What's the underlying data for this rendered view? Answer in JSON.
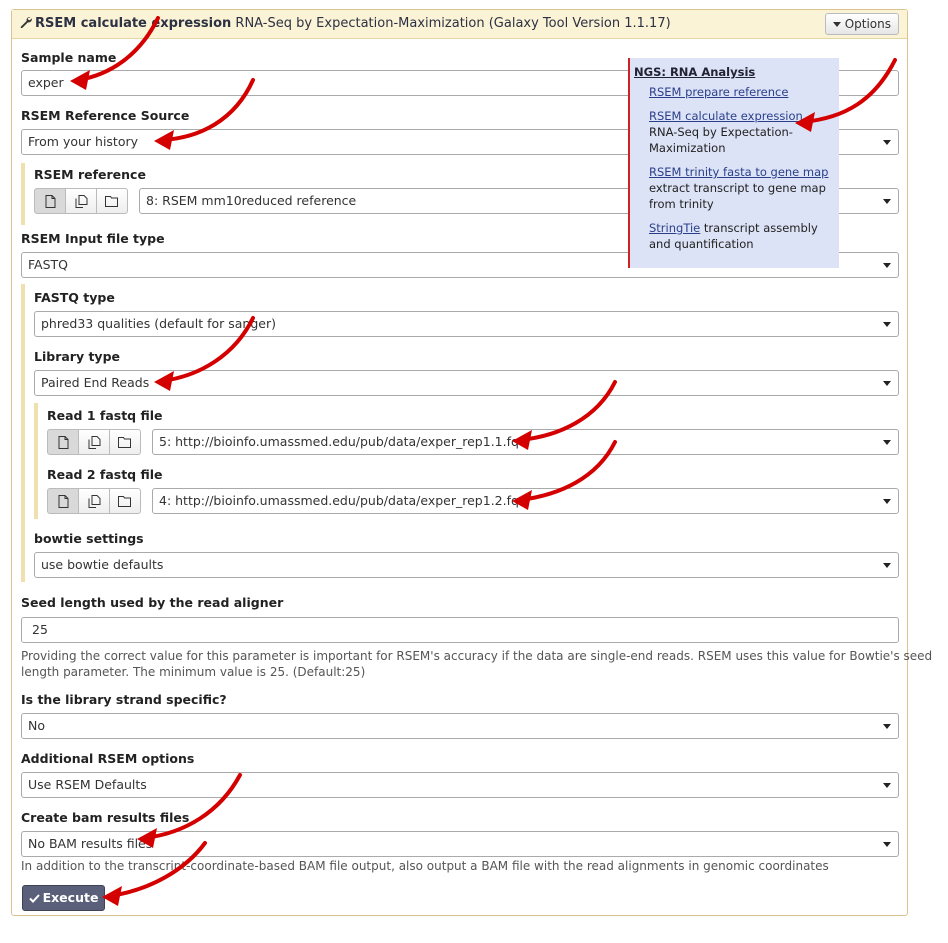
{
  "header": {
    "tool_name": "RSEM calculate expression",
    "tool_desc": "RNA-Seq by Expectation-Maximization (Galaxy Tool Version 1.1.17)",
    "options_label": "Options"
  },
  "form": {
    "sample_name": {
      "label": "Sample name",
      "value": "exper"
    },
    "ref_source": {
      "label": "RSEM Reference Source",
      "value": "From your history"
    },
    "rsem_reference": {
      "label": "RSEM reference",
      "value": "8: RSEM mm10reduced reference"
    },
    "input_type": {
      "label": "RSEM Input file type",
      "value": "FASTQ"
    },
    "fastq_type": {
      "label": "FASTQ type",
      "value": "phred33 qualities (default for sanger)"
    },
    "library_type": {
      "label": "Library type",
      "value": "Paired End Reads"
    },
    "read1": {
      "label": "Read 1 fastq file",
      "value": "5: http://bioinfo.umassmed.edu/pub/data/exper_rep1.1.fq"
    },
    "read2": {
      "label": "Read 2 fastq file",
      "value": "4: http://bioinfo.umassmed.edu/pub/data/exper_rep1.2.fq"
    },
    "bowtie": {
      "label": "bowtie settings",
      "value": "use bowtie defaults"
    },
    "seed": {
      "label": "Seed length used by the read aligner",
      "value": "25",
      "help1": "Providing the correct value for this parameter is important for RSEM's accuracy if the data are single-end reads. RSEM uses this value for Bowtie's seed",
      "help2": "length parameter. The minimum value is 25. (Default:25)"
    },
    "strand": {
      "label": "Is the library strand specific?",
      "value": "No"
    },
    "additional": {
      "label": "Additional RSEM options",
      "value": "Use RSEM Defaults"
    },
    "bam": {
      "label": "Create bam results files",
      "value": "No BAM results files",
      "help": "In addition to the transcript-coordinate-based BAM file output, also output a BAM file with the read alignments in genomic coordinates"
    },
    "execute_label": "Execute"
  },
  "popup": {
    "heading": "NGS: RNA Analysis",
    "items": [
      {
        "link": "RSEM prepare reference",
        "desc": ""
      },
      {
        "link": "RSEM calculate expression",
        "desc1": "RNA-Seq by Expectation-",
        "desc2": "Maximization"
      },
      {
        "link": "RSEM trinity fasta to gene map",
        "desc1": "extract transcript to gene map",
        "desc2": "from trinity"
      },
      {
        "link": "StringTie",
        "desc1": " transcript assembly",
        "desc2": "and quantification"
      }
    ]
  },
  "icons": [
    "wrench-icon",
    "caret-down-icon",
    "file-icon",
    "files-icon",
    "folder-icon",
    "check-icon"
  ],
  "colors": {
    "header_bg": "#fbf3d6",
    "execute_bg": "#5a6079",
    "popup_bg": "#dde3f6",
    "arrow": "#d40000"
  }
}
